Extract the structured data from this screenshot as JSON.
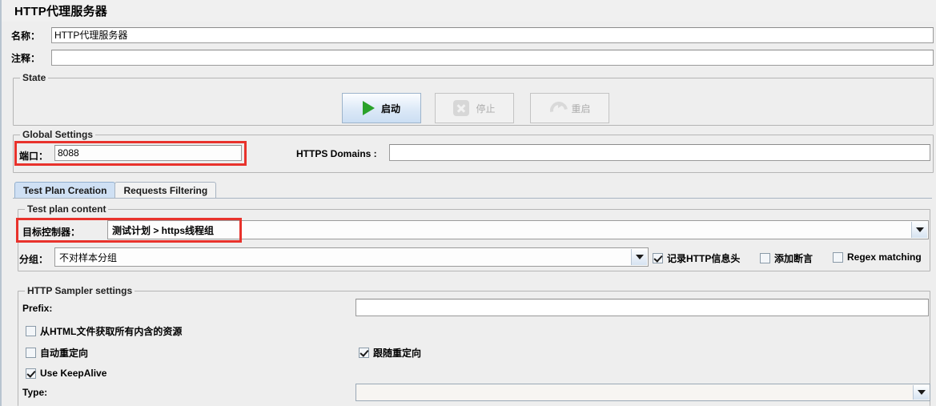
{
  "window": {
    "title": "HTTP代理服务器"
  },
  "fields": {
    "name_label": "名称：",
    "name_value": "HTTP代理服务器",
    "comment_label": "注释：",
    "comment_value": ""
  },
  "state": {
    "group_title": "State",
    "buttons": [
      {
        "label": "启动",
        "icon": "play-icon",
        "enabled": true
      },
      {
        "label": "停止",
        "icon": "stop-icon",
        "enabled": false
      },
      {
        "label": "重启",
        "icon": "restart-icon",
        "enabled": false
      }
    ]
  },
  "global_settings": {
    "group_title": "Global Settings",
    "port_label": "端口：",
    "port_value": "8088",
    "https_domains_label": "HTTPS Domains :",
    "https_domains_value": ""
  },
  "tabs": [
    {
      "label": "Test Plan Creation",
      "active": true
    },
    {
      "label": "Requests Filtering",
      "active": false
    }
  ],
  "test_plan_content": {
    "group_title": "Test plan content",
    "target_controller_label": "目标控制器：",
    "target_controller_value": "测试计划 > https线程组",
    "grouping_label": "分组：",
    "grouping_value": "不对样本分组",
    "checkboxes": [
      {
        "label": "记录HTTP信息头",
        "checked": true
      },
      {
        "label": "添加断言",
        "checked": false
      },
      {
        "label": "Regex matching",
        "checked": false
      }
    ]
  },
  "sampler_settings": {
    "group_title": "HTTP Sampler settings",
    "prefix_label": "Prefix:",
    "prefix_value": "",
    "embedded_label": "从HTML文件获取所有内含的资源",
    "auto_redirect_label": "自动重定向",
    "follow_redirect_label": "跟随重定向",
    "keepalive_label": "Use KeepAlive",
    "type_label": "Type:",
    "type_value": ""
  },
  "annotations": {
    "highlight_color": "#e8322c"
  }
}
